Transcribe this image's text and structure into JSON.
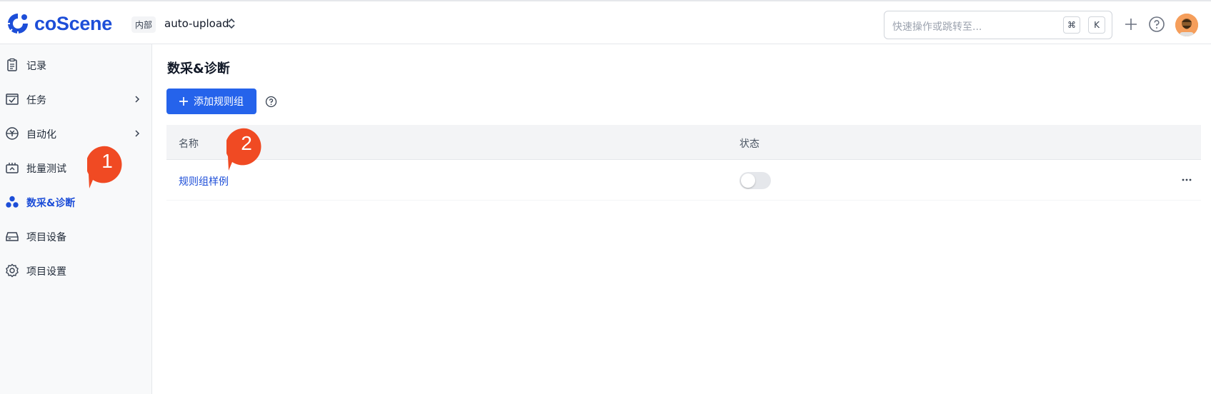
{
  "header": {
    "logo_text": "coScene",
    "project_tag": "内部",
    "project_name": "auto-upload",
    "search": {
      "placeholder": "快速操作或跳转至...",
      "kbd_cmd": "⌘",
      "kbd_k": "K"
    }
  },
  "sidebar": {
    "items": [
      {
        "label": "记录",
        "icon": "records-icon",
        "has_chevron": false,
        "active": false
      },
      {
        "label": "任务",
        "icon": "tasks-icon",
        "has_chevron": true,
        "active": false
      },
      {
        "label": "自动化",
        "icon": "automation-icon",
        "has_chevron": true,
        "active": false
      },
      {
        "label": "批量测试",
        "icon": "batch-test-icon",
        "has_chevron": false,
        "active": false
      },
      {
        "label": "数采&诊断",
        "icon": "data-collection-icon",
        "has_chevron": false,
        "active": true
      },
      {
        "label": "项目设备",
        "icon": "device-icon",
        "has_chevron": false,
        "active": false
      },
      {
        "label": "项目设置",
        "icon": "gear-icon",
        "has_chevron": false,
        "active": false
      }
    ]
  },
  "main": {
    "title": "数采&诊断",
    "add_button_label": "添加规则组",
    "table": {
      "columns": [
        "名称",
        "状态"
      ],
      "rows": [
        {
          "name": "规则组样例",
          "enabled": false
        }
      ]
    }
  },
  "annotations": {
    "marker_1": "1",
    "marker_2": "2"
  },
  "colors": {
    "accent": "#2563eb",
    "marker": "#f04a23"
  }
}
